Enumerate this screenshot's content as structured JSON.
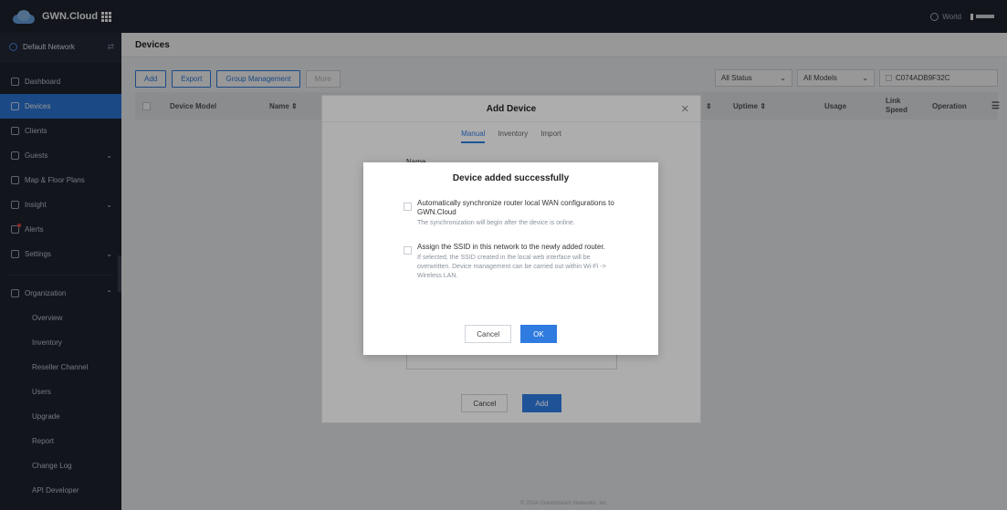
{
  "topbar": {
    "brand": "GWN.Cloud",
    "region": "World"
  },
  "sidebar": {
    "network": "Default Network",
    "items": [
      {
        "label": "Dashboard",
        "icon": "dashboard-icon"
      },
      {
        "label": "Devices",
        "icon": "devices-icon"
      },
      {
        "label": "Clients",
        "icon": "clients-icon"
      },
      {
        "label": "Guests",
        "icon": "guests-icon"
      },
      {
        "label": "Map & Floor Plans",
        "icon": "map-icon"
      },
      {
        "label": "Insight",
        "icon": "insight-icon"
      },
      {
        "label": "Alerts",
        "icon": "alerts-icon"
      },
      {
        "label": "Settings",
        "icon": "settings-icon"
      },
      {
        "label": "Organization",
        "icon": "organization-icon"
      }
    ],
    "org_sub": [
      "Overview",
      "Inventory",
      "Reseller Channel",
      "Users",
      "Upgrade",
      "Report",
      "Change Log",
      "API Developer"
    ]
  },
  "main": {
    "title": "Devices",
    "toolbar": {
      "add": "Add",
      "export": "Export",
      "group": "Group Management",
      "more": "More"
    },
    "filters": {
      "status": "All Status",
      "models": "All Models",
      "search": "C074ADB9F32C"
    },
    "columns": {
      "model": "Device Model",
      "name": "Name",
      "uptime": "Uptime",
      "usage": "Usage",
      "link": "Link Speed",
      "operation": "Operation"
    },
    "footer": "© 2024 Grandstream Networks, Inc."
  },
  "add_dialog": {
    "title": "Add Device",
    "tabs": [
      "Manual",
      "Inventory",
      "Import"
    ],
    "name_label": "Name",
    "cancel": "Cancel",
    "add": "Add"
  },
  "success": {
    "title": "Device added successfully",
    "opt1": "Automatically synchronize router local WAN configurations to GWN.Cloud",
    "opt1_desc": "The synchronization will begin after the device is online.",
    "opt2": "Assign the SSID in this network to the newly added router.",
    "opt2_desc": "If selected, the SSID created in the local web interface will be overwritten. Device management can be carried out within Wi-Fi -> Wireless LAN.",
    "cancel": "Cancel",
    "ok": "OK"
  },
  "colors": {
    "accent": "#2f7be0",
    "sidebar_bg": "#1f2430"
  }
}
